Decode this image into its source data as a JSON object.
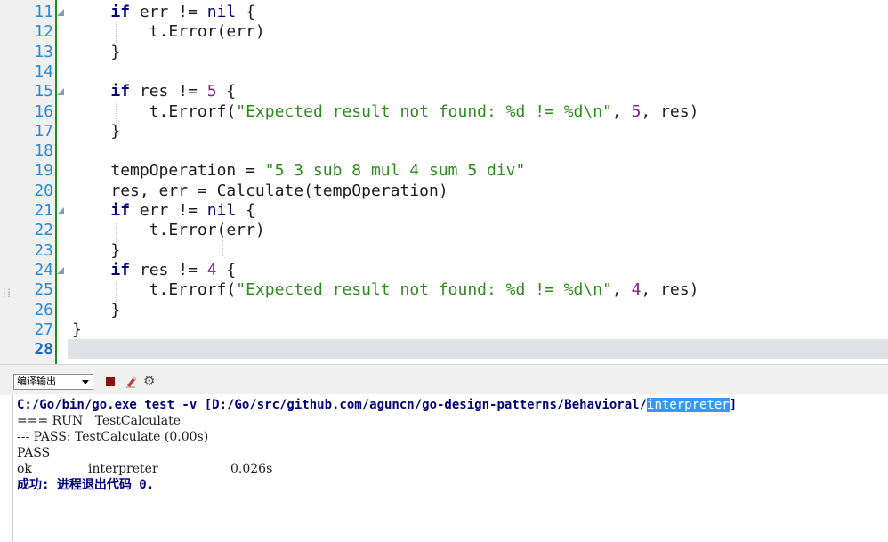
{
  "editor": {
    "current_line": "28",
    "lines": [
      {
        "num": "11",
        "indent": "    ",
        "tokens": [
          {
            "t": "if",
            "c": "kw"
          },
          {
            "t": " err != ",
            "c": "ident"
          },
          {
            "t": "nil",
            "c": "nil"
          },
          {
            "t": " {",
            "c": "ident"
          }
        ],
        "fold": true
      },
      {
        "num": "12",
        "indent": "        ",
        "tokens": [
          {
            "t": "t.Error(err)",
            "c": "ident"
          }
        ],
        "fold": false
      },
      {
        "num": "13",
        "indent": "    ",
        "tokens": [
          {
            "t": "}",
            "c": "ident"
          }
        ],
        "fold": false
      },
      {
        "num": "14",
        "indent": "",
        "tokens": [],
        "fold": false
      },
      {
        "num": "15",
        "indent": "    ",
        "tokens": [
          {
            "t": "if",
            "c": "kw"
          },
          {
            "t": " res != ",
            "c": "ident"
          },
          {
            "t": "5",
            "c": "num"
          },
          {
            "t": " {",
            "c": "ident"
          }
        ],
        "fold": true
      },
      {
        "num": "16",
        "indent": "        ",
        "tokens": [
          {
            "t": "t.Errorf(",
            "c": "ident"
          },
          {
            "t": "\"Expected result not found: %d != %d\\n\"",
            "c": "str"
          },
          {
            "t": ", ",
            "c": "ident"
          },
          {
            "t": "5",
            "c": "num"
          },
          {
            "t": ", res)",
            "c": "ident"
          }
        ],
        "fold": false
      },
      {
        "num": "17",
        "indent": "    ",
        "tokens": [
          {
            "t": "}",
            "c": "ident"
          }
        ],
        "fold": false
      },
      {
        "num": "18",
        "indent": "",
        "tokens": [],
        "fold": false
      },
      {
        "num": "19",
        "indent": "    ",
        "tokens": [
          {
            "t": "tempOperation = ",
            "c": "ident"
          },
          {
            "t": "\"5 3 sub 8 mul 4 sum 5 div\"",
            "c": "str"
          }
        ],
        "fold": false
      },
      {
        "num": "20",
        "indent": "    ",
        "tokens": [
          {
            "t": "res, err = Calculate(tempOperation)",
            "c": "ident"
          }
        ],
        "fold": false
      },
      {
        "num": "21",
        "indent": "    ",
        "tokens": [
          {
            "t": "if",
            "c": "kw"
          },
          {
            "t": " err != ",
            "c": "ident"
          },
          {
            "t": "nil",
            "c": "nil"
          },
          {
            "t": " {",
            "c": "ident"
          }
        ],
        "fold": true
      },
      {
        "num": "22",
        "indent": "        ",
        "tokens": [
          {
            "t": "t.Error(err)",
            "c": "ident"
          }
        ],
        "fold": false
      },
      {
        "num": "23",
        "indent": "    ",
        "tokens": [
          {
            "t": "}",
            "c": "ident"
          }
        ],
        "fold": false
      },
      {
        "num": "24",
        "indent": "    ",
        "tokens": [
          {
            "t": "if",
            "c": "kw"
          },
          {
            "t": " res != ",
            "c": "ident"
          },
          {
            "t": "4",
            "c": "num"
          },
          {
            "t": " {",
            "c": "ident"
          }
        ],
        "fold": true
      },
      {
        "num": "25",
        "indent": "        ",
        "tokens": [
          {
            "t": "t.Errorf(",
            "c": "ident"
          },
          {
            "t": "\"Expected result not found: %d != %d\\n\"",
            "c": "str"
          },
          {
            "t": ", ",
            "c": "ident"
          },
          {
            "t": "4",
            "c": "num"
          },
          {
            "t": ", res)",
            "c": "ident"
          }
        ],
        "fold": false
      },
      {
        "num": "26",
        "indent": "    ",
        "tokens": [
          {
            "t": "}",
            "c": "ident"
          }
        ],
        "fold": false
      },
      {
        "num": "27",
        "indent": "",
        "tokens": [
          {
            "t": "}",
            "c": "ident"
          }
        ],
        "fold": false
      },
      {
        "num": "28",
        "indent": "",
        "tokens": [],
        "fold": false
      }
    ]
  },
  "panel": {
    "output_select_value": "编译输出",
    "stop_icon": "stop-icon",
    "clear_icon": "clear-icon",
    "settings_icon": "gear-icon",
    "gear_glyph": "⚙"
  },
  "output": {
    "command_prefix": "C:/Go/bin/go.exe test -v [D:/Go/src/github.com/aguncn/go-design-patterns/Behavioral/",
    "command_selected": "interpreter",
    "command_suffix": "]",
    "run_line": "=== RUN   TestCalculate",
    "pass_line": "--- PASS: TestCalculate (0.00s)",
    "pass": "PASS",
    "ok_line": "ok      \tinterpreter\t0.026s",
    "ok_label": "ok",
    "ok_pkg": "interpreter",
    "ok_time": "0.026s",
    "success_line": "成功: 进程退出代码 0."
  },
  "colors": {
    "keyword": "#000080",
    "string": "#2e8b1e",
    "number": "#8b1e8b",
    "line_number": "#2b8ad8",
    "fold_bar": "#1e8c1e",
    "current_line_bg": "#dfe3e8",
    "selection": "#3399ff"
  }
}
